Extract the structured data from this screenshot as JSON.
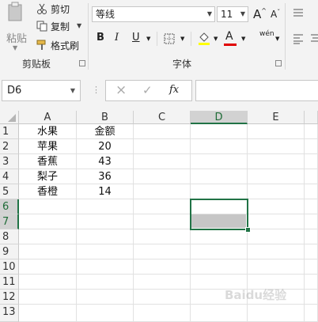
{
  "ribbon": {
    "clipboard": {
      "paste_label": "粘贴",
      "cut_label": "剪切",
      "copy_label": "复制",
      "format_painter_label": "格式刷",
      "group_label": "剪贴板"
    },
    "font": {
      "font_name": "等线",
      "font_size": "11",
      "grow_label": "A",
      "shrink_label": "A",
      "bold_label": "B",
      "italic_label": "I",
      "underline_label": "U",
      "phonetic_label": "wén",
      "font_color_label": "A",
      "group_label": "字体",
      "fill_color": "#ffff00",
      "font_color": "#e00000"
    }
  },
  "formula_bar": {
    "name_box": "D6",
    "cancel_icon": "×",
    "enter_icon": "✓",
    "fx_label": "fx",
    "content": ""
  },
  "sheet": {
    "columns": [
      "A",
      "B",
      "C",
      "D",
      "E"
    ],
    "selected_column": "D",
    "rows": [
      "1",
      "2",
      "3",
      "4",
      "5",
      "6",
      "7",
      "8",
      "9",
      "10",
      "11",
      "12",
      "13"
    ],
    "selected_rows": [
      "6",
      "7"
    ],
    "cells": [
      [
        "水果",
        "金额"
      ],
      [
        "苹果",
        "20"
      ],
      [
        "香蕉",
        "43"
      ],
      [
        "梨子",
        "36"
      ],
      [
        "香橙",
        "14"
      ]
    ],
    "selection": "D6:D7"
  },
  "watermark": "Baidu经验"
}
